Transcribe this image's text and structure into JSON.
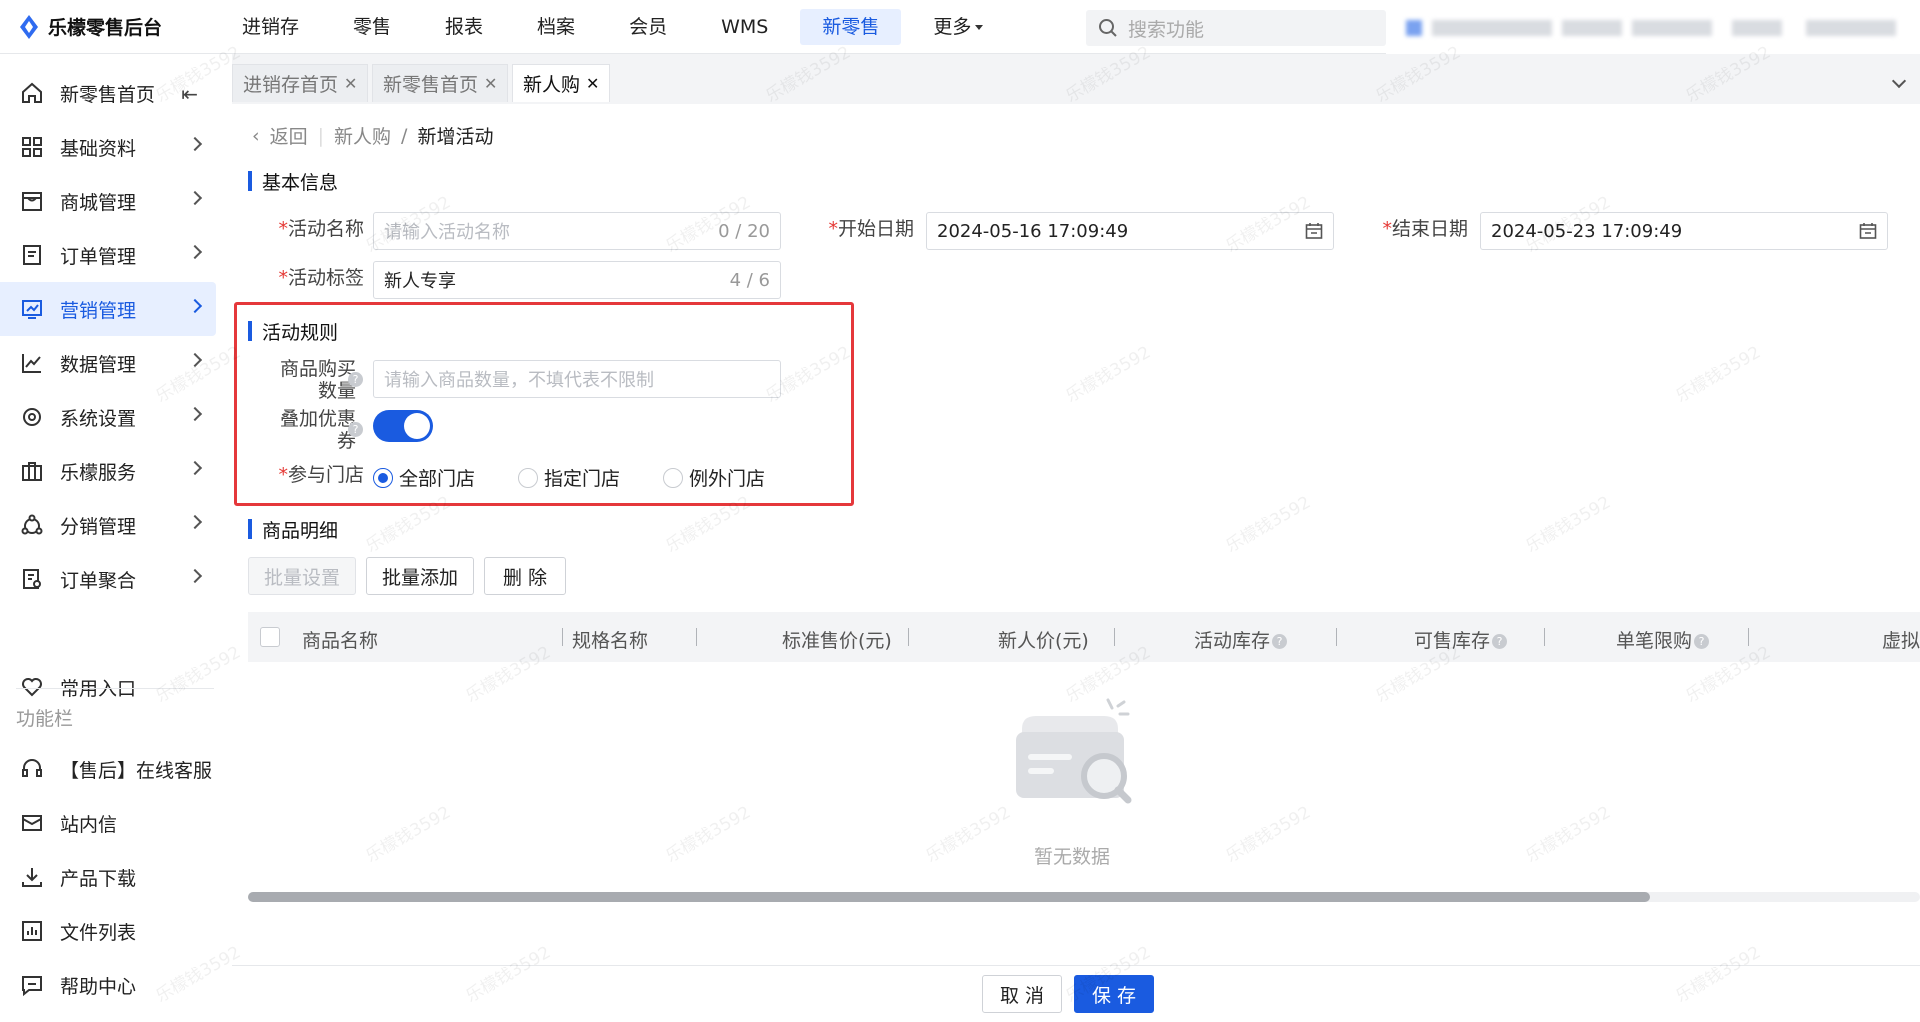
{
  "app": {
    "title": "乐檬零售后台"
  },
  "topnav": [
    {
      "label": "进销存",
      "active": false
    },
    {
      "label": "零售",
      "active": false
    },
    {
      "label": "报表",
      "active": false
    },
    {
      "label": "档案",
      "active": false
    },
    {
      "label": "会员",
      "active": false
    },
    {
      "label": "WMS",
      "active": false
    },
    {
      "label": "新零售",
      "active": true
    },
    {
      "label": "更多",
      "active": false
    }
  ],
  "search": {
    "placeholder": "搜索功能"
  },
  "sidebar": {
    "items": [
      {
        "label": "新零售首页",
        "icon": "home-icon"
      },
      {
        "label": "基础资料",
        "icon": "grid-icon"
      },
      {
        "label": "商城管理",
        "icon": "store-icon"
      },
      {
        "label": "订单管理",
        "icon": "order-icon"
      },
      {
        "label": "营销管理",
        "icon": "marketing-icon",
        "active": true
      },
      {
        "label": "数据管理",
        "icon": "chart-icon"
      },
      {
        "label": "系统设置",
        "icon": "settings-icon"
      },
      {
        "label": "乐檬服务",
        "icon": "briefcase-icon"
      },
      {
        "label": "分销管理",
        "icon": "distribution-icon"
      },
      {
        "label": "订单聚合",
        "icon": "aggregate-icon"
      }
    ],
    "favorite": "常用入口",
    "caption": "功能栏",
    "tools": [
      {
        "label": "【售后】在线客服",
        "icon": "headset-icon"
      },
      {
        "label": "站内信",
        "icon": "mail-icon"
      },
      {
        "label": "产品下载",
        "icon": "download-icon"
      },
      {
        "label": "文件列表",
        "icon": "file-list-icon"
      },
      {
        "label": "帮助中心",
        "icon": "help-icon"
      }
    ]
  },
  "tabs": [
    {
      "label": "进销存首页",
      "active": false
    },
    {
      "label": "新零售首页",
      "active": false
    },
    {
      "label": "新人购",
      "active": true
    }
  ],
  "breadcrumb": {
    "back": "返回",
    "parent": "新人购",
    "sep": "/",
    "current": "新增活动"
  },
  "basic": {
    "title": "基本信息",
    "name_label": "活动名称",
    "name_placeholder": "请输入活动名称",
    "name_count": "0 / 20",
    "start_label": "开始日期",
    "start_value": "2024-05-16 17:09:49",
    "end_label": "结束日期",
    "end_value": "2024-05-23 17:09:49",
    "tag_label": "活动标签",
    "tag_value": "新人专享",
    "tag_count": "4 / 6",
    "required_mark": "*"
  },
  "rules": {
    "title": "活动规则",
    "qty_label_1": "商品购买",
    "qty_label_2": "数量",
    "qty_placeholder": "请输入商品数量，不填代表不限制",
    "coupon_label_1": "叠加优惠",
    "coupon_label_2": "券",
    "coupon_on": true,
    "store_label": "参与门店",
    "store_options": [
      {
        "label": "全部门店",
        "selected": true
      },
      {
        "label": "指定门店",
        "selected": false
      },
      {
        "label": "例外门店",
        "selected": false
      }
    ],
    "help_glyph": "?"
  },
  "products": {
    "title": "商品明细",
    "batch_set": "批量设置",
    "batch_add": "批量添加",
    "delete": "删 除",
    "columns": [
      "商品名称",
      "规格名称",
      "标准售价(元)",
      "新人价(元)",
      "活动库存",
      "可售库存",
      "单笔限购",
      "虚拟"
    ],
    "empty_text": "暂无数据"
  },
  "footer": {
    "cancel": "取 消",
    "save": "保 存"
  },
  "colors": {
    "accent": "#1a5be0",
    "highlight_box": "#e5383b"
  }
}
